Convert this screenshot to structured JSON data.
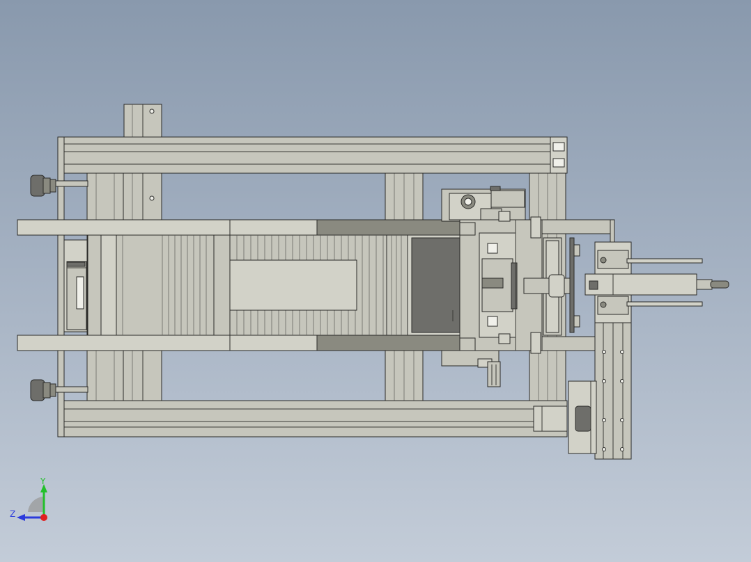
{
  "viewport": {
    "background_top": "#8999ad",
    "background_bottom": "#c3ccd8",
    "model": "mechanical-assembly-top-view"
  },
  "triad": {
    "y_label": "Y",
    "z_label": "Z",
    "y_color": "#22c02a",
    "z_color": "#2a3adc",
    "x_color": "#e02020"
  }
}
